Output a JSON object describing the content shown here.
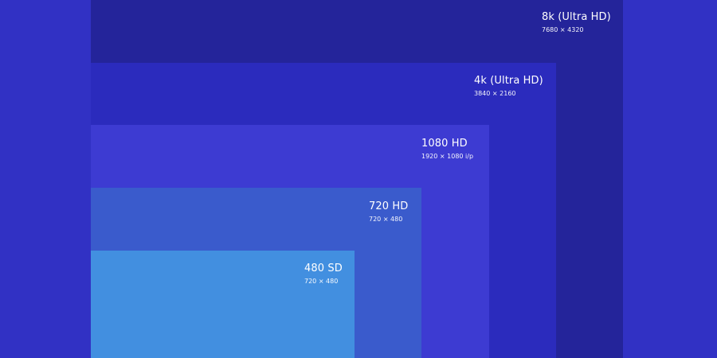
{
  "colors": {
    "background": "#3131c4",
    "box_8k": "#24249a",
    "box_4k": "#2b2bbd",
    "box_1080": "#3d3bd2",
    "box_720": "#3a5bcc",
    "box_480": "#428fe0"
  },
  "resolutions": [
    {
      "id": "8k",
      "title": "8k (Ultra HD)",
      "dimensions": "7680 × 4320"
    },
    {
      "id": "4k",
      "title": "4k (Ultra HD)",
      "dimensions": "3840 × 2160"
    },
    {
      "id": "1080",
      "title": "1080 HD",
      "dimensions": "1920 × 1080 i/p"
    },
    {
      "id": "720",
      "title": "720 HD",
      "dimensions": "720 × 480"
    },
    {
      "id": "480",
      "title": "480 SD",
      "dimensions": "720 × 480"
    }
  ]
}
